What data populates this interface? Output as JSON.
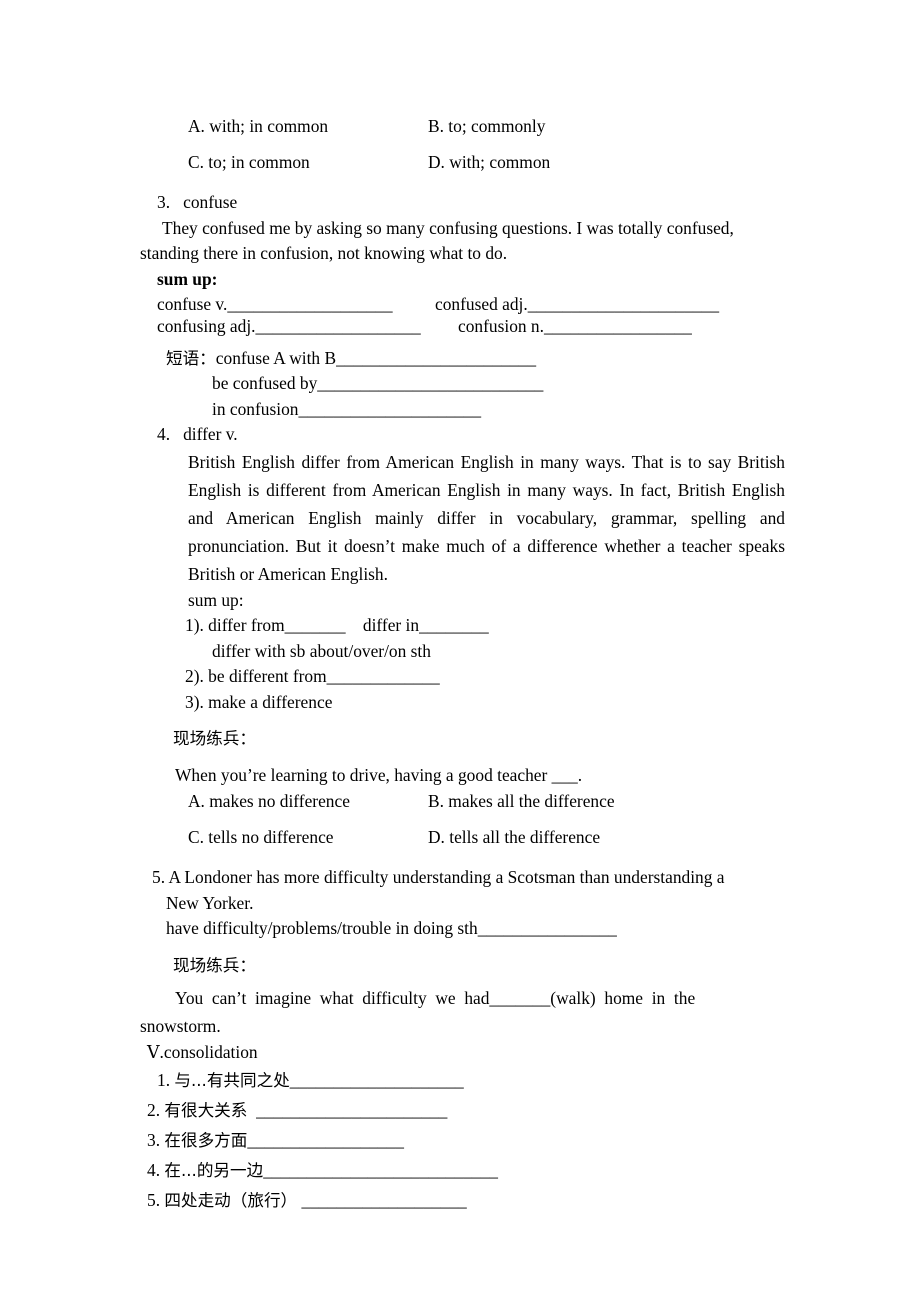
{
  "document": {
    "type": "worksheet",
    "language": "mixed-en-zh",
    "background_color": "#ffffff",
    "text_color": "#000000"
  },
  "question2_options": {
    "option_a": "A. with; in common",
    "option_b": "B. to; commonly",
    "option_c": "C. to; in common",
    "option_d": "D. with; common"
  },
  "item3": {
    "number": "3.",
    "word": "confuse",
    "example_line1": "They confused me by asking so many confusing questions. I was totally confused,",
    "example_line2": "standing there in confusion, not knowing what to do.",
    "sum_up_label": "sum up:",
    "forms": {
      "verb": "confuse v.",
      "verb_blank": "___________________",
      "adj_confused": "confused adj.",
      "adj_confused_blank": "______________________",
      "adj_confusing": "confusing adj.",
      "adj_confusing_blank": "___________________",
      "noun_confusion": "confusion n.",
      "noun_confusion_blank": "_________________"
    },
    "phrases_label": "短语：",
    "phrases": [
      {
        "text": "confuse A with B",
        "blank": "_______________________"
      },
      {
        "text": "be confused by",
        "blank": "__________________________"
      },
      {
        "text": "in confusion",
        "blank": "_____________________"
      }
    ]
  },
  "item4": {
    "number": "4.",
    "word": "differ v.",
    "paragraph": "British English differ from American English in many ways. That is to say British English is different from American English in many ways. In fact, British English and American English mainly differ in vocabulary, grammar, spelling and pronunciation. But it doesn’t make much of a difference whether a teacher speaks British or American English.",
    "paragraph_lines": [
      "British English differ from American English in many ways. That is to say",
      "British English is different from American English in many ways. In fact,",
      "British English and American English mainly differ in vocabulary, grammar,",
      "spelling and pronunciation. But it doesn’t make much of a difference whether a",
      "teacher speaks British or American English."
    ],
    "sum_up_label": "sum up:",
    "sum_up_items": [
      {
        "label": "1). differ from",
        "blank": "_______",
        "second_label": "differ in",
        "second_blank": "________"
      },
      {
        "label": "differ with sb about/over/on sth",
        "blank": ""
      },
      {
        "label": "2). be different from",
        "blank": "_____________"
      },
      {
        "label": "3). make a difference",
        "blank": ""
      }
    ],
    "practice_label": "现场练兵：",
    "practice_question": "When you’re learning to drive, having a good teacher ___.",
    "practice_options": {
      "option_a": "A. makes no difference",
      "option_b": "B. makes all the difference",
      "option_c": "C. tells no difference",
      "option_d": "D. tells all the difference"
    }
  },
  "item5": {
    "number": "5.",
    "sentence_line1": "A Londoner has more difficulty understanding a Scotsman than understanding a",
    "sentence_line2": "New Yorker.",
    "pattern": "have difficulty/problems/trouble in doing sth",
    "pattern_blank": "________________",
    "practice_label": "现场练兵：",
    "practice_sentence_line1": "You  can’t  imagine  what  difficulty  we  had_______(walk)  home  in  the",
    "practice_sentence_line2": "snowstorm."
  },
  "consolidation": {
    "heading": "Ⅴ.consolidation",
    "items": [
      {
        "number": "1.",
        "text": "与...有共同之处",
        "blank": "____________________"
      },
      {
        "number": "2.",
        "text": "有很大关系",
        "blank": "______________________"
      },
      {
        "number": "3.",
        "text": "在很多方面",
        "blank": "__________________"
      },
      {
        "number": "4.",
        "text": "在...的另一边",
        "blank": "___________________________"
      },
      {
        "number": "5.",
        "text": "四处走动（旅行）",
        "blank": "___________________"
      }
    ]
  }
}
